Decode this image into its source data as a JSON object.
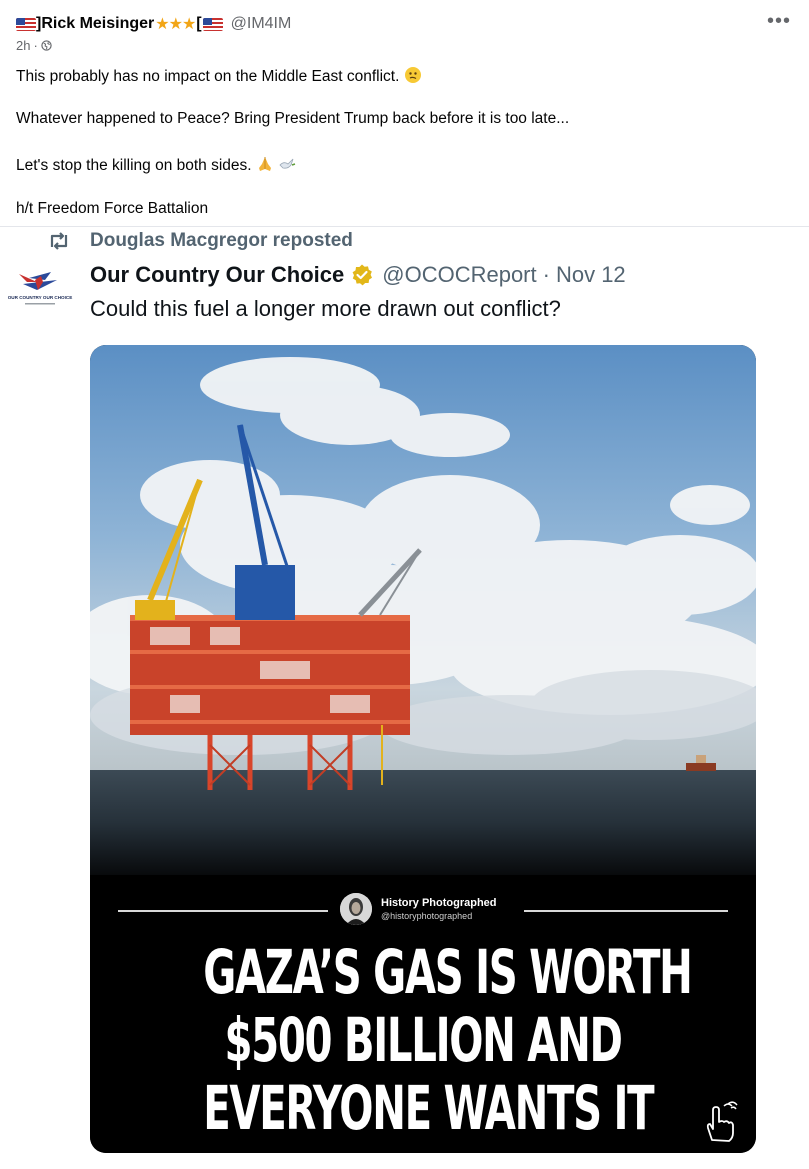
{
  "post": {
    "author_name": "]Rick Meisinger",
    "stars": "★★★",
    "bracket": "[",
    "handle": "@IM4IM",
    "time": "2h",
    "separator": "·",
    "more": "•••",
    "lines": [
      "This probably has no impact on the Middle East conflict.",
      "Whatever happened to Peace? Bring President Trump back before it is too late...",
      "Let's stop the killing on both sides.",
      "h/t Freedom Force Battalion"
    ]
  },
  "repost": {
    "reposted_by": "Douglas Macgregor reposted",
    "logo_text": "OUR COUNTRY OUR CHOICE",
    "account_name": "Our Country Our Choice",
    "handle": "@OCOCReport",
    "separator": "·",
    "date": "Nov 12",
    "text": "Could this fuel a longer more drawn out conflict?"
  },
  "image": {
    "source_name": "History Photographed",
    "source_handle": "@historyphotographed",
    "headline": [
      "GAZA’S GAS IS WORTH",
      "$500 BILLION AND",
      "EVERYONE WANTS IT"
    ]
  },
  "colors": {
    "star": "#f2a516",
    "verified": "#e2b719",
    "muted": "#536471",
    "rig_red": "#d8452a",
    "crane_blue": "#2558a8",
    "crane_yellow": "#e3b21c"
  },
  "icons": [
    "us-flag-icon",
    "star-icon",
    "globe-icon",
    "more-icon",
    "thinking-emoji",
    "pray-emoji",
    "dove-emoji",
    "repost-icon",
    "verified-badge-icon",
    "hand-pointer-icon"
  ]
}
